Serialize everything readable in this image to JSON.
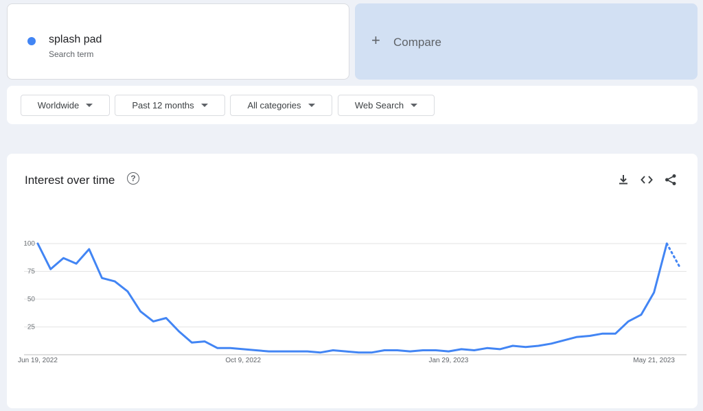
{
  "search_term": {
    "name": "splash pad",
    "subtitle": "Search term",
    "color": "#4285f4"
  },
  "compare": {
    "label": "Compare",
    "icon": "plus-icon"
  },
  "filters": [
    {
      "label": "Worldwide"
    },
    {
      "label": "Past 12 months"
    },
    {
      "label": "All categories"
    },
    {
      "label": "Web Search"
    }
  ],
  "chart_card": {
    "title": "Interest over time",
    "icons": [
      "help-icon",
      "download-icon",
      "embed-icon",
      "share-icon"
    ]
  },
  "chart_data": {
    "type": "line",
    "title": "Interest over time",
    "ylim": [
      0,
      100
    ],
    "yticks": [
      25,
      50,
      75,
      100
    ],
    "grid": true,
    "line_color": "#4285f4",
    "x_tick_labels": [
      {
        "label": "Jun 19, 2022",
        "index": 0
      },
      {
        "label": "Oct 9, 2022",
        "index": 16
      },
      {
        "label": "Jan 29, 2023",
        "index": 32
      },
      {
        "label": "May 21, 2023",
        "index": 48
      }
    ],
    "series": [
      {
        "values": [
          100,
          77,
          87,
          82,
          95,
          69,
          66,
          57,
          39,
          30,
          33,
          21,
          11,
          12,
          6,
          6,
          5,
          4,
          3,
          3,
          3,
          3,
          2,
          4,
          3,
          2,
          2,
          4,
          4,
          3,
          4,
          4,
          3,
          5,
          4,
          6,
          5,
          8,
          7,
          8,
          10,
          13,
          16,
          17,
          19,
          19,
          30,
          36,
          56,
          100,
          79
        ],
        "partial_last": true
      }
    ]
  }
}
